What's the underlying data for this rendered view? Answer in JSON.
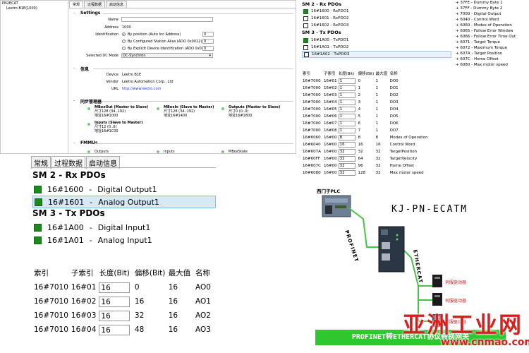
{
  "panelA": {
    "tree": [
      "PN2ECAT",
      "Leetro B1E(1000)"
    ],
    "tabs": [
      "常规",
      "过程数据",
      "启动信息"
    ],
    "settings": {
      "title": "Settings",
      "name_label": "Name",
      "address_label": "Address",
      "address_value": "1000",
      "identification_label": "Identification",
      "radios": [
        "By position (Auto Inc Address)",
        "By Configured Station Alias (ADO 0x0012)",
        "By Explicit Device Identification (ADO 0x0134)"
      ],
      "radio_values": [
        "0",
        "0",
        "0"
      ],
      "dc_label": "Selected DC Mode",
      "dc_value": "DC-Synchron"
    },
    "info": {
      "title": "信息",
      "device_label": "Device",
      "device_value": "Leetro B1E",
      "vendor_label": "Vendor",
      "vendor_value": "Leetro Automation Corp., Ltd",
      "url_label": "URL",
      "url_value": "http://www.leetro.com"
    },
    "sync": {
      "title": "同步管理器",
      "mboxout": {
        "title": "MBoxOut (Master to Slave)",
        "size": "尺寸128 (34..192)",
        "addr": "地址16#1000"
      },
      "mboxin": {
        "title": "MBoxIn (Slave to Master)",
        "size": "尺寸128 (34..192)",
        "addr": "地址16#1400"
      },
      "outputs": {
        "title": "Outputs (Master to Slave)",
        "size": "尺寸0 (0..0)",
        "addr": "地址16#1800"
      },
      "inputs": {
        "title": "Inputs (Slave to Master)",
        "size": "尺寸12 (0..0)",
        "addr": "地址16#1C00"
      }
    },
    "fmmus": {
      "title": "FMMUs",
      "cols": [
        "Outputs",
        "Inputs",
        "MBoxState"
      ]
    }
  },
  "panelB": {
    "sm2_title": "SM 2 - Rx PDOs",
    "rx": [
      {
        "idx": "16#1600",
        "name": "RxPDO1",
        "checked": true
      },
      {
        "idx": "16#1601",
        "name": "RxPDO2",
        "checked": false
      },
      {
        "idx": "16#1602",
        "name": "RxPDO3",
        "checked": false
      }
    ],
    "sm3_title": "SM 3 - Tx PDOs",
    "tx": [
      {
        "idx": "16#1A00",
        "name": "TxPDO1",
        "checked": true
      },
      {
        "idx": "16#1A01",
        "name": "TxPDO2",
        "checked": false
      },
      {
        "idx": "16#1A02",
        "name": "TxPDO3",
        "checked": false
      }
    ],
    "headers": [
      "索引",
      "子索引",
      "长度(Bit)",
      "偏移(Bit)",
      "最大值",
      "名称"
    ],
    "rows": [
      [
        "16#7000",
        "16#01",
        "1",
        "0",
        "1",
        "DO0"
      ],
      [
        "16#7000",
        "16#02",
        "1",
        "1",
        "1",
        "DO1"
      ],
      [
        "16#7000",
        "16#03",
        "1",
        "2",
        "1",
        "DO2"
      ],
      [
        "16#7000",
        "16#04",
        "1",
        "3",
        "1",
        "DO3"
      ],
      [
        "16#7000",
        "16#05",
        "1",
        "4",
        "1",
        "DO4"
      ],
      [
        "16#7000",
        "16#06",
        "1",
        "5",
        "1",
        "DO5"
      ],
      [
        "16#7000",
        "16#07",
        "1",
        "6",
        "1",
        "DO6"
      ],
      [
        "16#7000",
        "16#08",
        "1",
        "7",
        "1",
        "DO7"
      ],
      [
        "16#6060",
        "16#00",
        "8",
        "8",
        "8",
        "Modes of Operation"
      ],
      [
        "16#6040",
        "16#00",
        "16",
        "16",
        "16",
        "Control Word"
      ],
      [
        "16#607A",
        "16#00",
        "32",
        "32",
        "32",
        "TargetPosition"
      ],
      [
        "16#60FF",
        "16#00",
        "32",
        "64",
        "32",
        "TargetVelocity"
      ],
      [
        "16#607C",
        "16#00",
        "32",
        "96",
        "32",
        "Home Offset"
      ],
      [
        "16#6080",
        "16#00",
        "32",
        "128",
        "32",
        "Max motor speed"
      ]
    ]
  },
  "panelC": {
    "items": [
      "37FE - Dummy Byte 1",
      "37FF - Dummy Byte 2",
      "7000 - Digital Output",
      "6040 - Control Word",
      "6060 - Modes of Operation",
      "6065 - Follow Error Window",
      "6066 - Follow Error Time Out",
      "6071 - Target Torque",
      "6072 - Maximum Torque",
      "607A - Target Position",
      "607C - Home Offset",
      "6080 - Max motor speed"
    ]
  },
  "panelD": {
    "tabs": [
      "常规",
      "过程数据",
      "启动信息"
    ],
    "sm2_title": "SM 2 - Rx PDOs",
    "rx": [
      {
        "idx": "16#1600",
        "name": "Digital Output1"
      },
      {
        "idx": "16#1601",
        "name": "Analog Output1"
      }
    ],
    "sm3_title": "SM 3 - Tx PDOs",
    "tx": [
      {
        "idx": "16#1A00",
        "name": "Digital Input1"
      },
      {
        "idx": "16#1A01",
        "name": "Analog Input1"
      }
    ],
    "sep": "-",
    "headers": [
      "索引",
      "子索引",
      "长度(Bit)",
      "偏移(Bit)",
      "最大值",
      "名称"
    ],
    "rows": [
      [
        "16#7010",
        "16#01",
        "16",
        "0",
        "16",
        "AO0"
      ],
      [
        "16#7010",
        "16#02",
        "16",
        "16",
        "16",
        "AO1"
      ],
      [
        "16#7010",
        "16#03",
        "16",
        "32",
        "16",
        "AO2"
      ],
      [
        "16#7010",
        "16#04",
        "16",
        "48",
        "16",
        "AO3"
      ]
    ]
  },
  "panelE": {
    "plc_label": "西门子PLC",
    "profinet_label": "PROFINET",
    "ethercat_label": "ETHERCAT",
    "title": "KJ-PN-ECATM",
    "servo_labels": [
      "伺服驱动器",
      "伺服驱动器",
      "伺服驱动器"
    ],
    "banner": "PROFINET转ETHERCAT协议转换网关",
    "watermark": "亚洲工业网",
    "watermark_url": "www.cnmao.com"
  }
}
